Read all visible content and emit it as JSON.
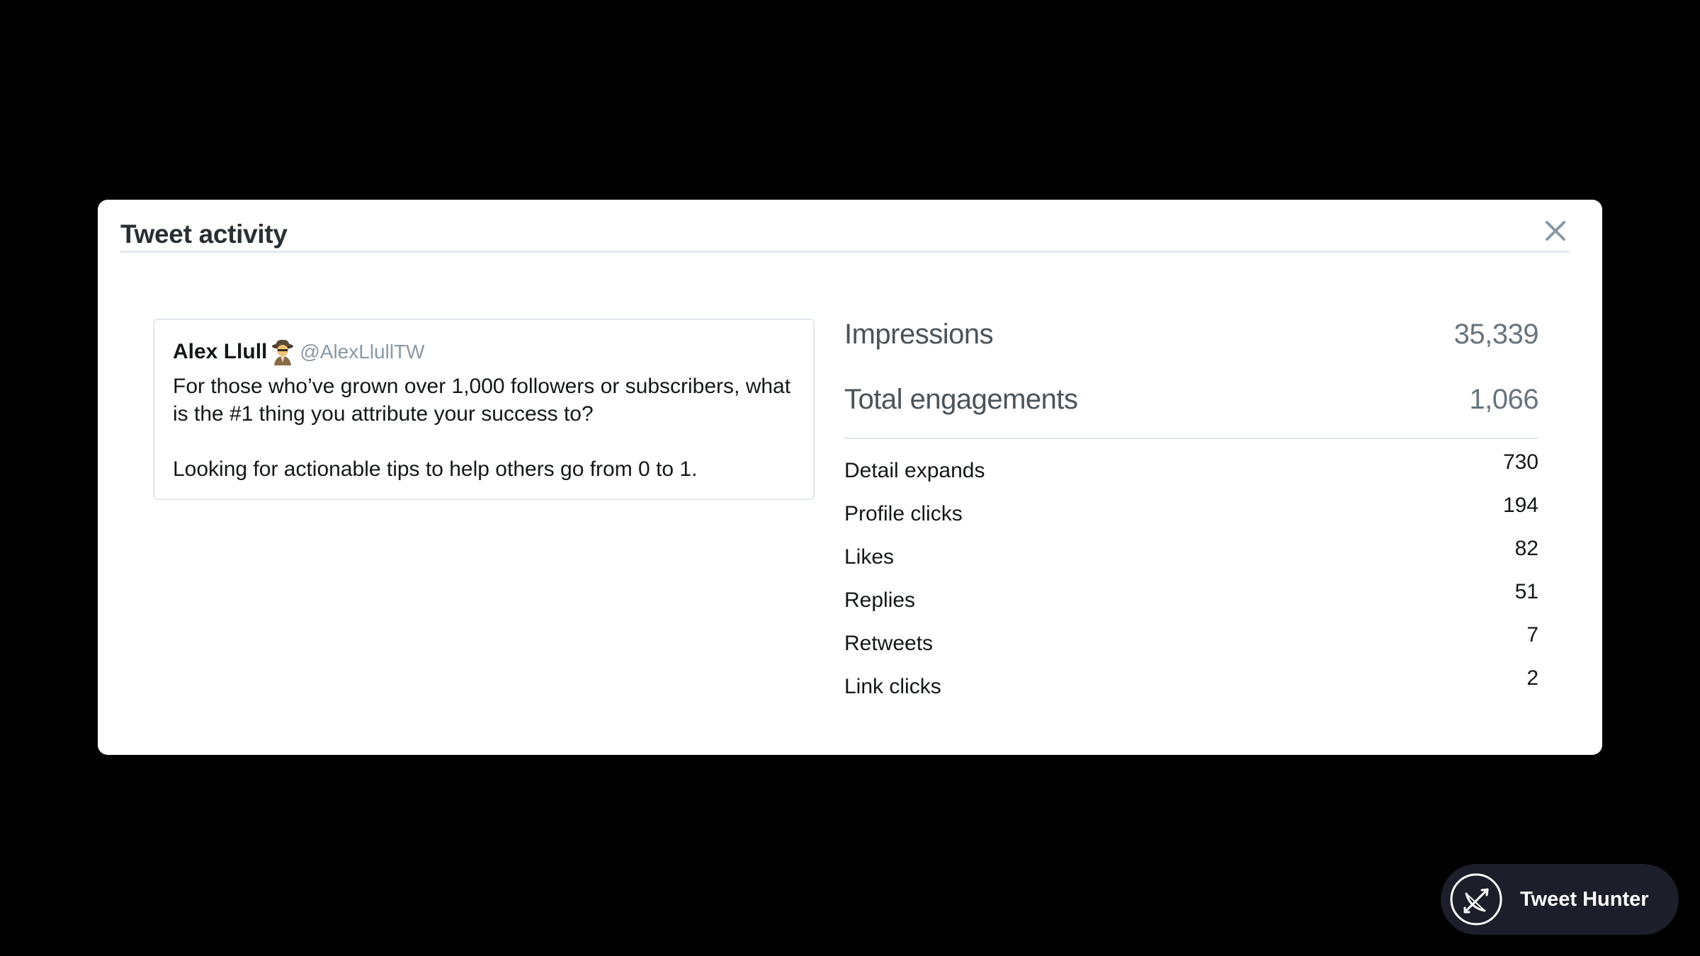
{
  "modal": {
    "title": "Tweet activity"
  },
  "tweet": {
    "author_name": "Alex Llull",
    "author_emoji": "detective-emoji",
    "author_handle": "@AlexLlullTW",
    "text_paragraphs": [
      "For those who’ve grown over 1,000 followers or subscribers, what is the #1 thing you attribute your success to?",
      "Looking for actionable tips to help others go from 0 to 1."
    ]
  },
  "stats": {
    "headline": [
      {
        "label": "Impressions",
        "value": "35,339"
      },
      {
        "label": "Total engagements",
        "value": "1,066"
      }
    ],
    "breakdown": [
      {
        "label": "Detail expands",
        "value": "730"
      },
      {
        "label": "Profile clicks",
        "value": "194"
      },
      {
        "label": "Likes",
        "value": "82"
      },
      {
        "label": "Replies",
        "value": "51"
      },
      {
        "label": "Retweets",
        "value": "7"
      },
      {
        "label": "Link clicks",
        "value": "2"
      }
    ]
  },
  "badge": {
    "label": "Tweet Hunter",
    "icon": "bow-arrow-icon"
  },
  "colors": {
    "background": "#000000",
    "modal": "#ffffff",
    "divider": "#e1e8ed",
    "handle": "#8899a6",
    "close_icon": "#8899a6",
    "badge_bg": "#1c1f2a"
  }
}
